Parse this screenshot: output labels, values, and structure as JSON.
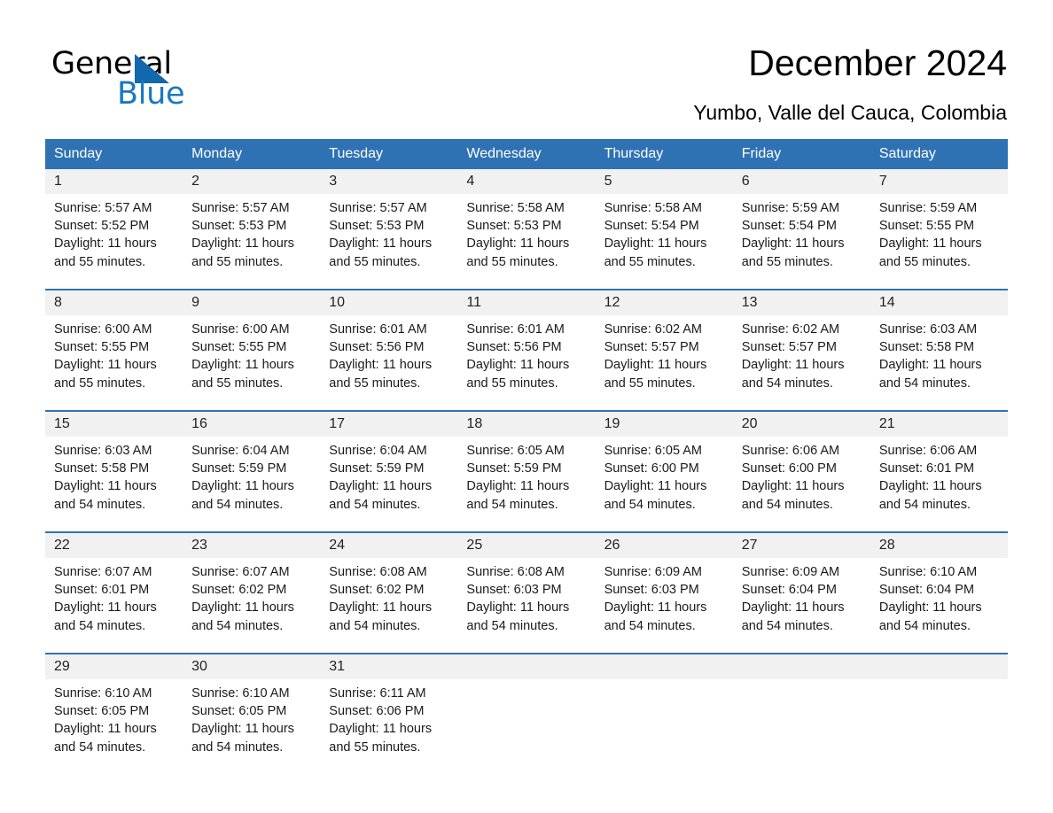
{
  "brand": {
    "name_part1": "General",
    "name_part2": "Blue",
    "logo_icon": "triangle-logo-icon",
    "accent_color": "#1878c4"
  },
  "header": {
    "title": "December 2024",
    "subtitle": "Yumbo, Valle del Cauca, Colombia"
  },
  "calendar": {
    "header_color": "#2f72b3",
    "day_band_color": "#f1f1f1",
    "weekdays": [
      "Sunday",
      "Monday",
      "Tuesday",
      "Wednesday",
      "Thursday",
      "Friday",
      "Saturday"
    ],
    "weeks": [
      [
        {
          "day": "1",
          "sunrise": "Sunrise: 5:57 AM",
          "sunset": "Sunset: 5:52 PM",
          "daylight": "Daylight: 11 hours and 55 minutes."
        },
        {
          "day": "2",
          "sunrise": "Sunrise: 5:57 AM",
          "sunset": "Sunset: 5:53 PM",
          "daylight": "Daylight: 11 hours and 55 minutes."
        },
        {
          "day": "3",
          "sunrise": "Sunrise: 5:57 AM",
          "sunset": "Sunset: 5:53 PM",
          "daylight": "Daylight: 11 hours and 55 minutes."
        },
        {
          "day": "4",
          "sunrise": "Sunrise: 5:58 AM",
          "sunset": "Sunset: 5:53 PM",
          "daylight": "Daylight: 11 hours and 55 minutes."
        },
        {
          "day": "5",
          "sunrise": "Sunrise: 5:58 AM",
          "sunset": "Sunset: 5:54 PM",
          "daylight": "Daylight: 11 hours and 55 minutes."
        },
        {
          "day": "6",
          "sunrise": "Sunrise: 5:59 AM",
          "sunset": "Sunset: 5:54 PM",
          "daylight": "Daylight: 11 hours and 55 minutes."
        },
        {
          "day": "7",
          "sunrise": "Sunrise: 5:59 AM",
          "sunset": "Sunset: 5:55 PM",
          "daylight": "Daylight: 11 hours and 55 minutes."
        }
      ],
      [
        {
          "day": "8",
          "sunrise": "Sunrise: 6:00 AM",
          "sunset": "Sunset: 5:55 PM",
          "daylight": "Daylight: 11 hours and 55 minutes."
        },
        {
          "day": "9",
          "sunrise": "Sunrise: 6:00 AM",
          "sunset": "Sunset: 5:55 PM",
          "daylight": "Daylight: 11 hours and 55 minutes."
        },
        {
          "day": "10",
          "sunrise": "Sunrise: 6:01 AM",
          "sunset": "Sunset: 5:56 PM",
          "daylight": "Daylight: 11 hours and 55 minutes."
        },
        {
          "day": "11",
          "sunrise": "Sunrise: 6:01 AM",
          "sunset": "Sunset: 5:56 PM",
          "daylight": "Daylight: 11 hours and 55 minutes."
        },
        {
          "day": "12",
          "sunrise": "Sunrise: 6:02 AM",
          "sunset": "Sunset: 5:57 PM",
          "daylight": "Daylight: 11 hours and 55 minutes."
        },
        {
          "day": "13",
          "sunrise": "Sunrise: 6:02 AM",
          "sunset": "Sunset: 5:57 PM",
          "daylight": "Daylight: 11 hours and 54 minutes."
        },
        {
          "day": "14",
          "sunrise": "Sunrise: 6:03 AM",
          "sunset": "Sunset: 5:58 PM",
          "daylight": "Daylight: 11 hours and 54 minutes."
        }
      ],
      [
        {
          "day": "15",
          "sunrise": "Sunrise: 6:03 AM",
          "sunset": "Sunset: 5:58 PM",
          "daylight": "Daylight: 11 hours and 54 minutes."
        },
        {
          "day": "16",
          "sunrise": "Sunrise: 6:04 AM",
          "sunset": "Sunset: 5:59 PM",
          "daylight": "Daylight: 11 hours and 54 minutes."
        },
        {
          "day": "17",
          "sunrise": "Sunrise: 6:04 AM",
          "sunset": "Sunset: 5:59 PM",
          "daylight": "Daylight: 11 hours and 54 minutes."
        },
        {
          "day": "18",
          "sunrise": "Sunrise: 6:05 AM",
          "sunset": "Sunset: 5:59 PM",
          "daylight": "Daylight: 11 hours and 54 minutes."
        },
        {
          "day": "19",
          "sunrise": "Sunrise: 6:05 AM",
          "sunset": "Sunset: 6:00 PM",
          "daylight": "Daylight: 11 hours and 54 minutes."
        },
        {
          "day": "20",
          "sunrise": "Sunrise: 6:06 AM",
          "sunset": "Sunset: 6:00 PM",
          "daylight": "Daylight: 11 hours and 54 minutes."
        },
        {
          "day": "21",
          "sunrise": "Sunrise: 6:06 AM",
          "sunset": "Sunset: 6:01 PM",
          "daylight": "Daylight: 11 hours and 54 minutes."
        }
      ],
      [
        {
          "day": "22",
          "sunrise": "Sunrise: 6:07 AM",
          "sunset": "Sunset: 6:01 PM",
          "daylight": "Daylight: 11 hours and 54 minutes."
        },
        {
          "day": "23",
          "sunrise": "Sunrise: 6:07 AM",
          "sunset": "Sunset: 6:02 PM",
          "daylight": "Daylight: 11 hours and 54 minutes."
        },
        {
          "day": "24",
          "sunrise": "Sunrise: 6:08 AM",
          "sunset": "Sunset: 6:02 PM",
          "daylight": "Daylight: 11 hours and 54 minutes."
        },
        {
          "day": "25",
          "sunrise": "Sunrise: 6:08 AM",
          "sunset": "Sunset: 6:03 PM",
          "daylight": "Daylight: 11 hours and 54 minutes."
        },
        {
          "day": "26",
          "sunrise": "Sunrise: 6:09 AM",
          "sunset": "Sunset: 6:03 PM",
          "daylight": "Daylight: 11 hours and 54 minutes."
        },
        {
          "day": "27",
          "sunrise": "Sunrise: 6:09 AM",
          "sunset": "Sunset: 6:04 PM",
          "daylight": "Daylight: 11 hours and 54 minutes."
        },
        {
          "day": "28",
          "sunrise": "Sunrise: 6:10 AM",
          "sunset": "Sunset: 6:04 PM",
          "daylight": "Daylight: 11 hours and 54 minutes."
        }
      ],
      [
        {
          "day": "29",
          "sunrise": "Sunrise: 6:10 AM",
          "sunset": "Sunset: 6:05 PM",
          "daylight": "Daylight: 11 hours and 54 minutes."
        },
        {
          "day": "30",
          "sunrise": "Sunrise: 6:10 AM",
          "sunset": "Sunset: 6:05 PM",
          "daylight": "Daylight: 11 hours and 54 minutes."
        },
        {
          "day": "31",
          "sunrise": "Sunrise: 6:11 AM",
          "sunset": "Sunset: 6:06 PM",
          "daylight": "Daylight: 11 hours and 55 minutes."
        },
        {
          "day": "",
          "sunrise": "",
          "sunset": "",
          "daylight": ""
        },
        {
          "day": "",
          "sunrise": "",
          "sunset": "",
          "daylight": ""
        },
        {
          "day": "",
          "sunrise": "",
          "sunset": "",
          "daylight": ""
        },
        {
          "day": "",
          "sunrise": "",
          "sunset": "",
          "daylight": ""
        }
      ]
    ]
  }
}
